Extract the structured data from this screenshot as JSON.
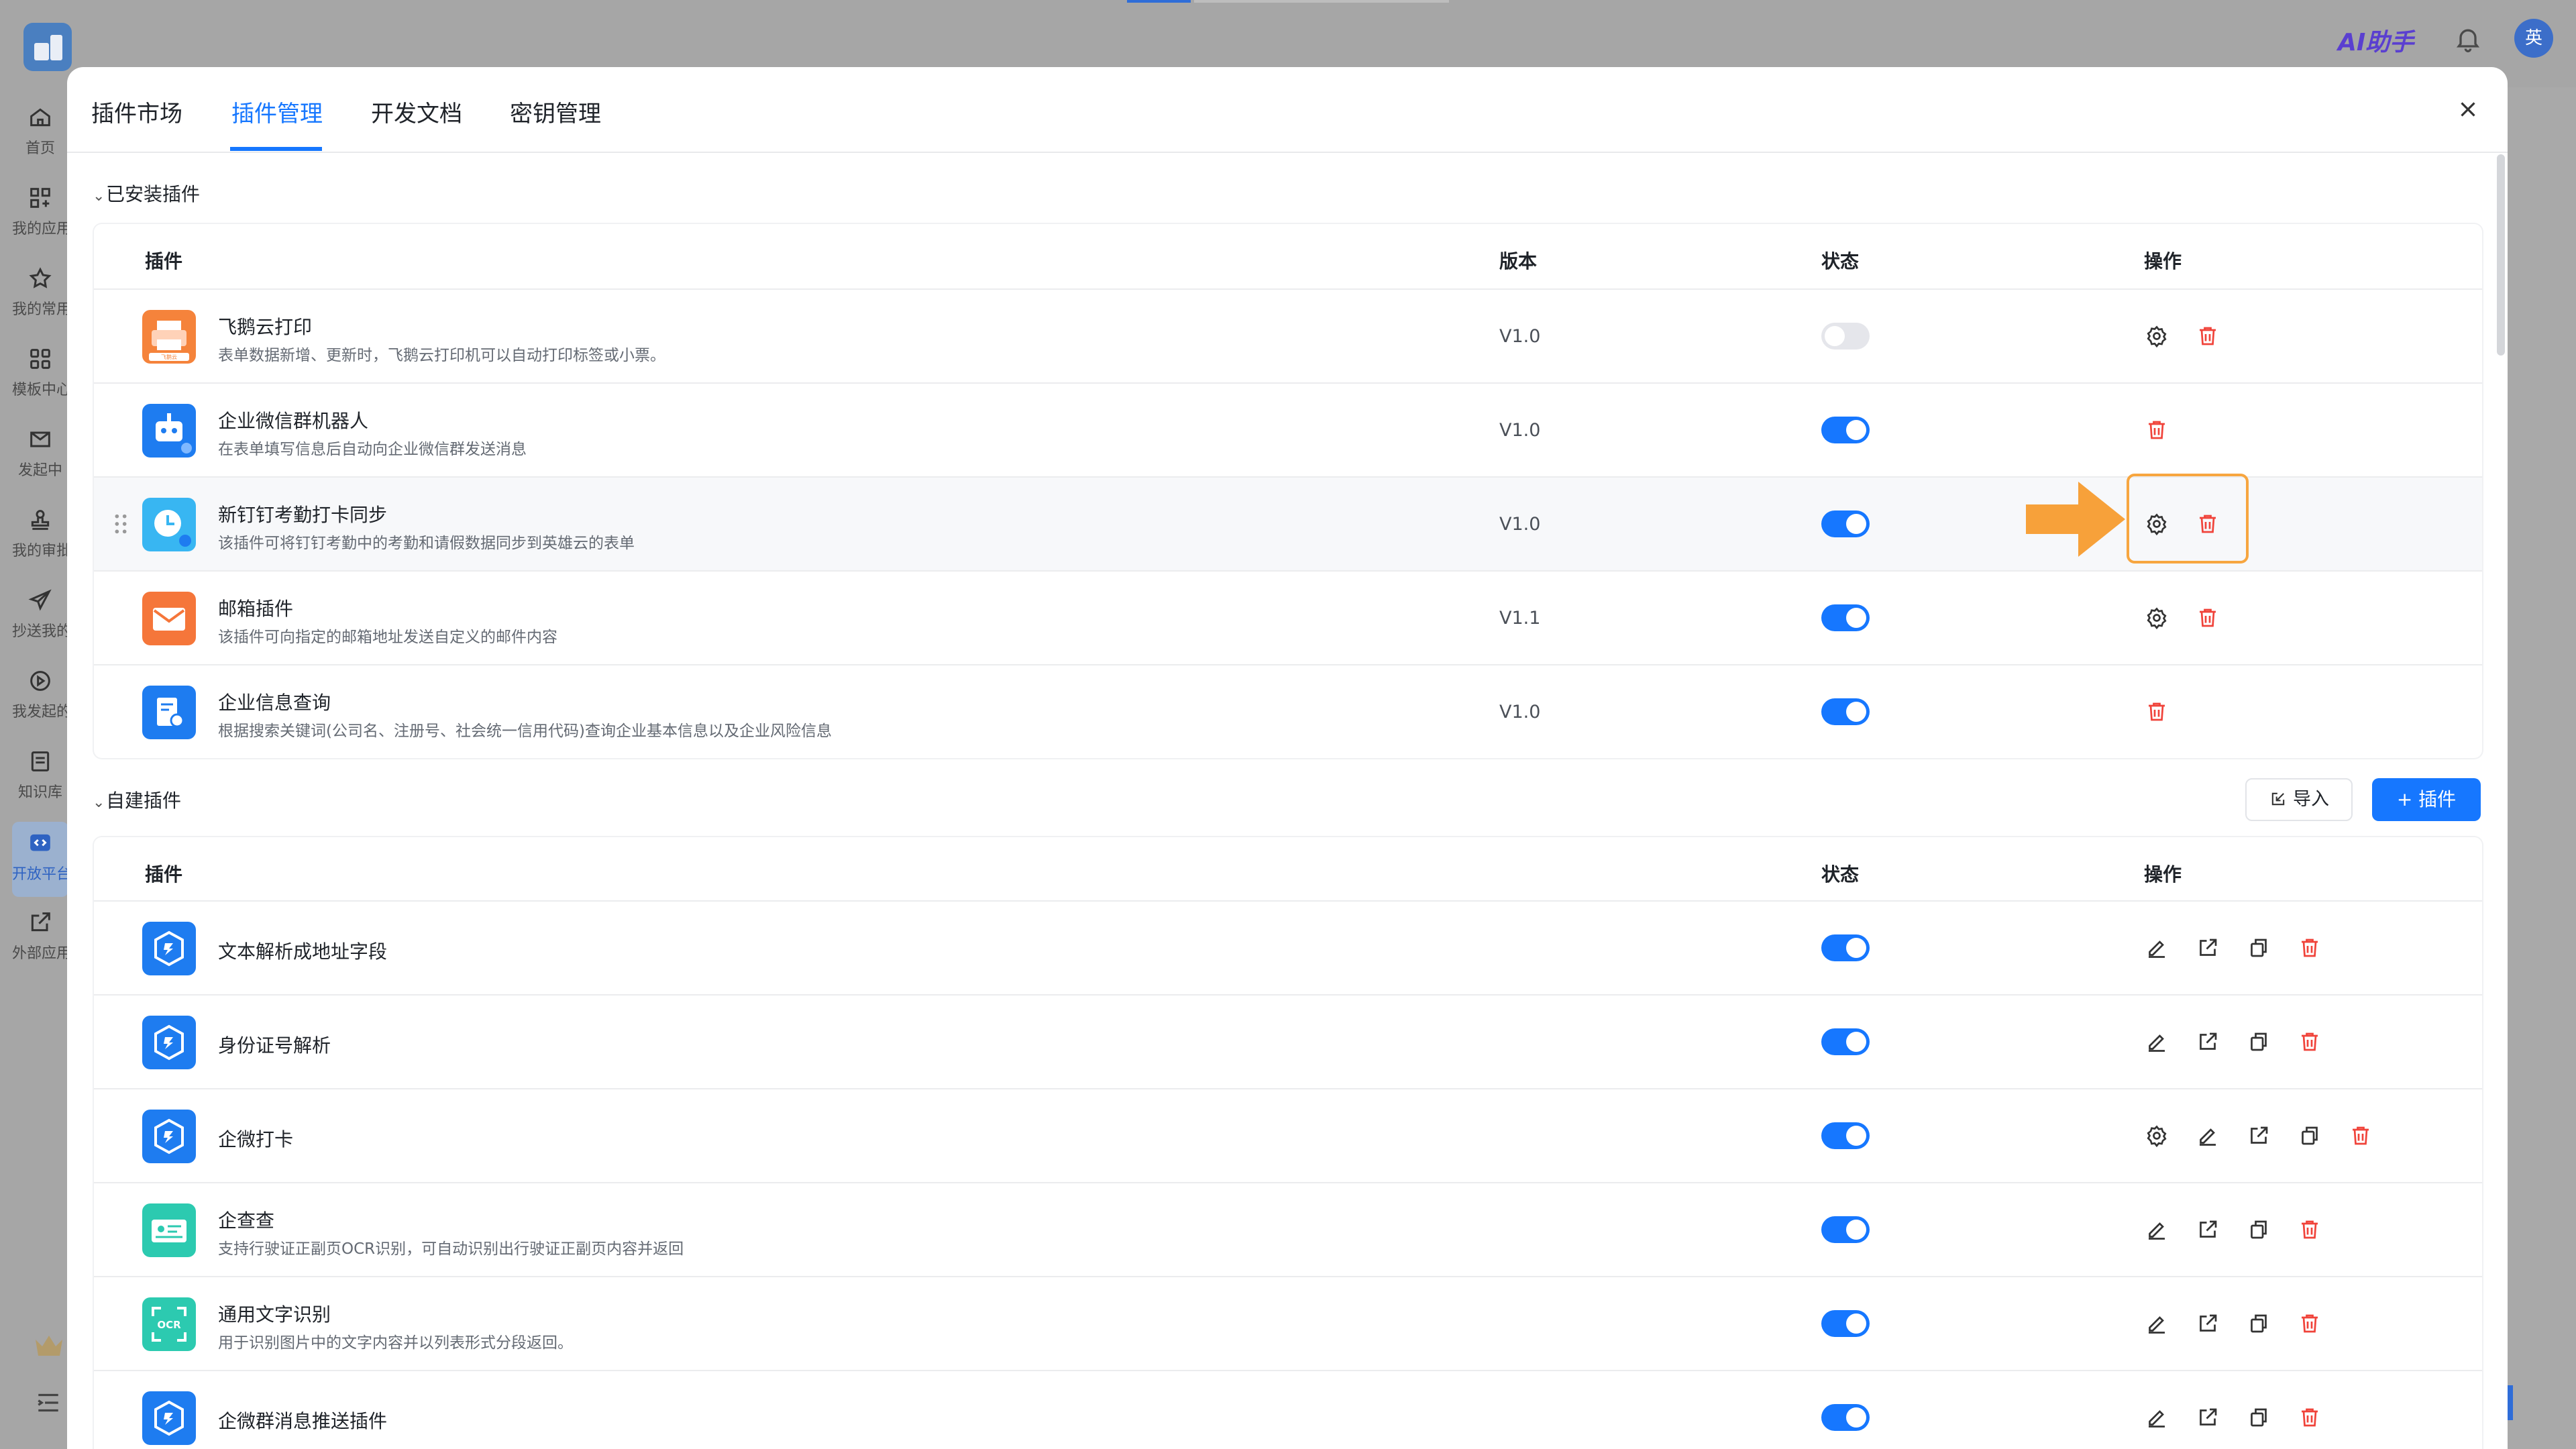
{
  "topbar": {
    "ai_label": "AI助手",
    "avatar_text": "英"
  },
  "nav": {
    "items": [
      {
        "label": "首页",
        "icon": "home-icon"
      },
      {
        "label": "我的应用",
        "icon": "apps-icon"
      },
      {
        "label": "我的常用",
        "icon": "star-icon"
      },
      {
        "label": "模板中心",
        "icon": "template-icon"
      },
      {
        "label": "发起中",
        "icon": "mail-icon"
      },
      {
        "label": "我的审批",
        "icon": "stamp-icon"
      },
      {
        "label": "抄送我的",
        "icon": "send-icon"
      },
      {
        "label": "我发起的",
        "icon": "play-icon"
      },
      {
        "label": "知识库",
        "icon": "book-icon"
      },
      {
        "label": "开放平台",
        "icon": "code-icon"
      },
      {
        "label": "外部应用",
        "icon": "external-icon"
      }
    ]
  },
  "modal": {
    "tabs": [
      "插件市场",
      "插件管理",
      "开发文档",
      "密钥管理"
    ],
    "active_tab": "插件管理"
  },
  "installed": {
    "title": "已安装插件",
    "headers": {
      "plugin": "插件",
      "version": "版本",
      "status": "状态",
      "actions": "操作"
    },
    "rows": [
      {
        "name": "飞鹅云打印",
        "desc": "表单数据新增、更新时，飞鹅云打印机可以自动打印标签或小票。",
        "version": "V1.0",
        "enabled": false,
        "icon_label": "飞鹅云",
        "icon_color": "#f5833b"
      },
      {
        "name": "企业微信群机器人",
        "desc": "在表单填写信息后自动向企业微信群发送消息",
        "version": "V1.0",
        "enabled": true,
        "icon_color": "#1e7cf0"
      },
      {
        "name": "新钉钉考勤打卡同步",
        "desc": "该插件可将钉钉考勤中的考勤和请假数据同步到英雄云的表单",
        "version": "V1.0",
        "enabled": true,
        "icon_color": "#38b6f2"
      },
      {
        "name": "邮箱插件",
        "desc": "该插件可向指定的邮箱地址发送自定义的邮件内容",
        "version": "V1.1",
        "enabled": true,
        "icon_color": "#f5763a"
      },
      {
        "name": "企业信息查询",
        "desc": "根据搜索关键词(公司名、注册号、社会统一信用代码)查询企业基本信息以及企业风险信息",
        "version": "V1.0",
        "enabled": true,
        "icon_color": "#1e7cf0"
      }
    ]
  },
  "custom": {
    "title": "自建插件",
    "import_label": "导入",
    "add_label": "+ 插件",
    "headers": {
      "plugin": "插件",
      "status": "状态",
      "actions": "操作"
    },
    "rows": [
      {
        "name": "文本解析成地址字段",
        "desc": "",
        "enabled": true,
        "icon_color": "#1e7cf0"
      },
      {
        "name": "身份证号解析",
        "desc": "",
        "enabled": true,
        "icon_color": "#1e7cf0"
      },
      {
        "name": "企微打卡",
        "desc": "",
        "enabled": true,
        "icon_color": "#1e7cf0"
      },
      {
        "name": "企查查",
        "desc": "支持行驶证正副页OCR识别，可自动识别出行驶证正副页内容并返回",
        "enabled": true,
        "icon_color": "#2ccab0"
      },
      {
        "name": "通用文字识别",
        "desc": "用于识别图片中的文字内容并以列表形式分段返回。",
        "enabled": true,
        "icon_label": "OCR",
        "icon_color": "#2ccab0"
      },
      {
        "name": "企微群消息推送插件",
        "desc": "",
        "enabled": true,
        "icon_color": "#1e7cf0"
      }
    ]
  }
}
